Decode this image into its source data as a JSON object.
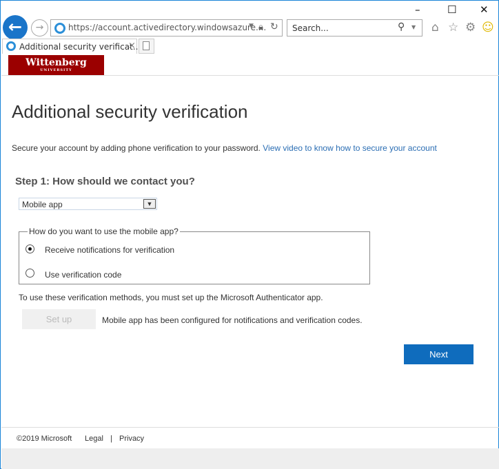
{
  "browser": {
    "url": "https://account.activedirectory.windowsazure....",
    "search_placeholder": "Search...",
    "tab_title": "Additional security verificat...",
    "tab_close": "×",
    "window_controls": {
      "minimize": "–",
      "maximize": "☐",
      "close": "✕"
    },
    "icons": [
      "back-icon",
      "forward-icon",
      "lock-icon",
      "refresh-icon",
      "search-icon",
      "home-icon",
      "star-icon",
      "gear-icon",
      "smiley-icon",
      "new-tab-icon"
    ]
  },
  "logo": {
    "name": "Wittenberg",
    "sub": "UNIVERSITY",
    "color": "#9b0000"
  },
  "page": {
    "title": "Additional security verification",
    "intro": "Secure your account by adding phone verification to your password.",
    "intro_link": "View video to know how to secure your account",
    "step_title": "Step 1: How should we contact you?",
    "contact_method": "Mobile app",
    "fieldset_legend": "How do you want to use the mobile app?",
    "options": [
      {
        "label": "Receive notifications for verification",
        "selected": true
      },
      {
        "label": "Use verification code",
        "selected": false
      }
    ],
    "note": "To use these verification methods, you must set up the Microsoft Authenticator app.",
    "setup_button": "Set up",
    "configured_status": "Mobile app has been configured for notifications and verification codes.",
    "next_button": "Next",
    "accent": "#0f6cbd"
  },
  "footer": {
    "copyright": "©2019 Microsoft",
    "legal": "Legal",
    "sep": "|",
    "privacy": "Privacy"
  }
}
